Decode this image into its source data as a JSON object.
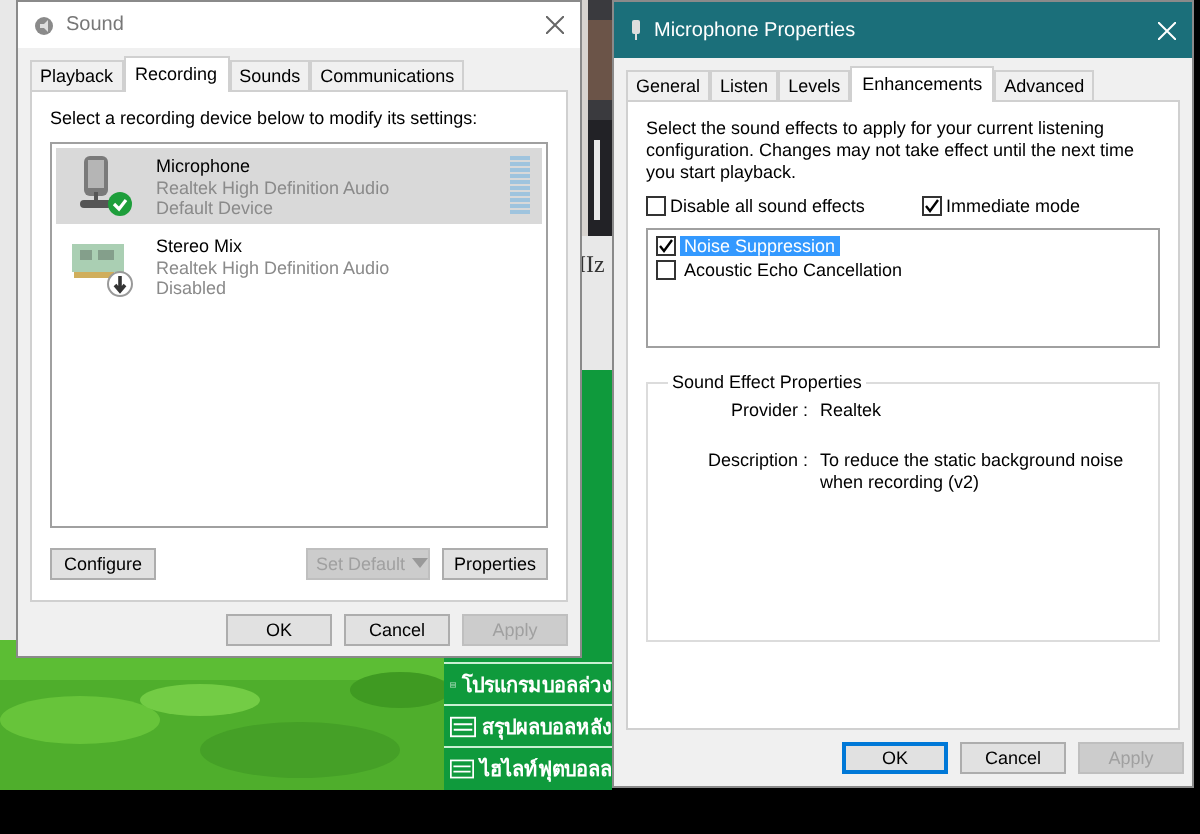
{
  "background_page": {
    "fragment": "IIz",
    "menu_items": [
      "โปรแกรมบอลล่วง",
      "สรุปผลบอลหลัง",
      "ไฮไลท์ฟุตบอลล"
    ]
  },
  "sound_window": {
    "title": "Sound",
    "tabs": [
      {
        "label": "Playback",
        "selected": false
      },
      {
        "label": "Recording",
        "selected": true
      },
      {
        "label": "Sounds",
        "selected": false
      },
      {
        "label": "Communications",
        "selected": false
      }
    ],
    "instruction": "Select a recording device below to modify its settings:",
    "devices": [
      {
        "kind": "microphone",
        "name": "Microphone",
        "driver": "Realtek High Definition Audio",
        "status": "Default Device",
        "default": true,
        "disabled": false,
        "selected": true
      },
      {
        "kind": "card",
        "name": "Stereo Mix",
        "driver": "Realtek High Definition Audio",
        "status": "Disabled",
        "default": false,
        "disabled": true,
        "selected": false
      }
    ],
    "device_buttons": [
      {
        "label": "Configure",
        "disabled": false,
        "kind": "plain"
      },
      {
        "label": "Set Default",
        "disabled": true,
        "kind": "split"
      },
      {
        "label": "Properties",
        "disabled": false,
        "kind": "plain"
      }
    ],
    "dialog_buttons": [
      {
        "label": "OK",
        "disabled": false,
        "focused": false
      },
      {
        "label": "Cancel",
        "disabled": false,
        "focused": false
      },
      {
        "label": "Apply",
        "disabled": true,
        "focused": false
      }
    ]
  },
  "properties_window": {
    "title": "Microphone Properties",
    "tabs": [
      {
        "label": "General",
        "selected": false
      },
      {
        "label": "Listen",
        "selected": false
      },
      {
        "label": "Levels",
        "selected": false
      },
      {
        "label": "Enhancements",
        "selected": true
      },
      {
        "label": "Advanced",
        "selected": false
      }
    ],
    "intro": "Select the sound effects to apply for your current listening configuration. Changes may not take effect until the next time you start playback.",
    "options": [
      {
        "label": "Disable all sound effects",
        "checked": false
      },
      {
        "label": "Immediate mode",
        "checked": true
      }
    ],
    "effects": [
      {
        "label": "Noise Suppression",
        "checked": true,
        "selected": true
      },
      {
        "label": "Acoustic Echo Cancellation",
        "checked": false,
        "selected": false
      }
    ],
    "group": {
      "title": "Sound Effect Properties",
      "rows": [
        {
          "label": "Provider :",
          "value": "Realtek"
        },
        {
          "label": "Description :",
          "value": "To reduce the static background noise when recording (v2)"
        }
      ]
    },
    "dialog_buttons": [
      {
        "label": "OK",
        "disabled": false,
        "focused": true
      },
      {
        "label": "Cancel",
        "disabled": false,
        "focused": false
      },
      {
        "label": "Apply",
        "disabled": true,
        "focused": false
      }
    ]
  }
}
